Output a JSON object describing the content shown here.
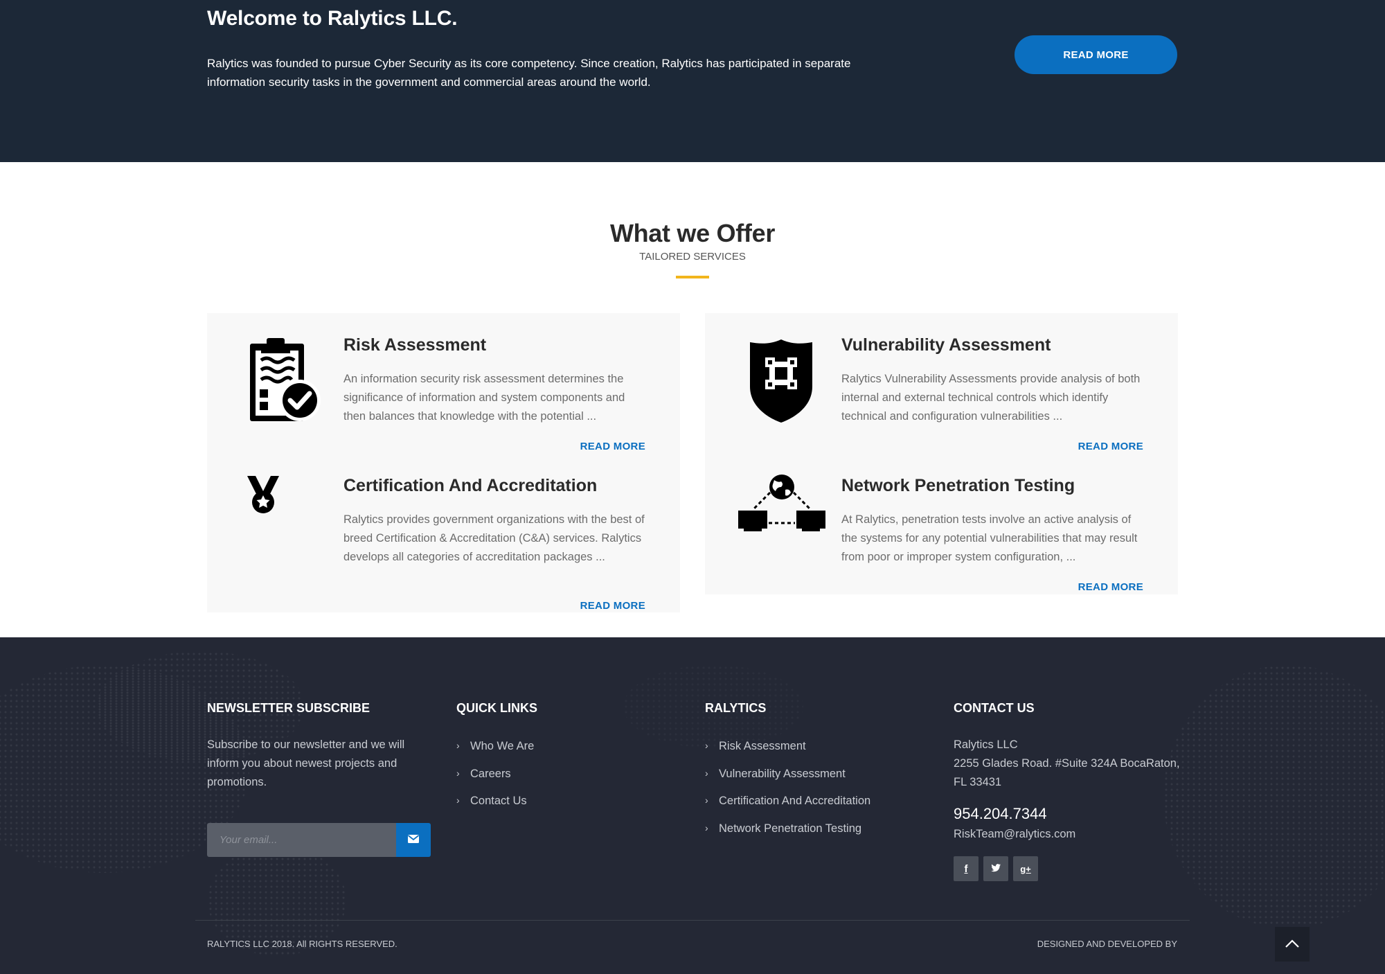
{
  "hero": {
    "title": "Welcome to Ralytics LLC.",
    "text": "Ralytics was founded to pursue Cyber Security as its core competency. Since creation, Ralytics has participated in separate information security tasks in the government and commercial areas around the world.",
    "button": "READ MORE"
  },
  "offer": {
    "title": "What we Offer",
    "subtitle": "TAILORED SERVICES",
    "services": [
      {
        "title": "Risk Assessment",
        "desc": "An information security risk assessment determines the significance of information and system components and then balances that knowledge with the potential ...",
        "more": "READ MORE",
        "icon": "clipboard-check-icon"
      },
      {
        "title": "Certification And Accreditation",
        "desc": "Ralytics provides government organizations with the best of breed Certification & Accreditation (C&A) services. Ralytics develops all categories of accreditation packages ...",
        "more": "READ MORE",
        "icon": "medal-icon"
      },
      {
        "title": "Vulnerability Assessment",
        "desc": "Ralytics Vulnerability Assessments provide analysis of both internal and external technical controls which identify technical and configuration vulnerabilities ...",
        "more": "READ MORE",
        "icon": "shield-icon"
      },
      {
        "title": "Network Penetration Testing",
        "desc": "At Ralytics, penetration tests involve an active analysis of the systems for any potential vulnerabilities that may result from poor or improper system configuration, ...",
        "more": "READ MORE",
        "icon": "network-icon"
      }
    ]
  },
  "footer": {
    "newsletter": {
      "heading": "NEWSLETTER SUBSCRIBE",
      "text": "Subscribe to our newsletter and we will inform you about newest projects and promotions.",
      "placeholder": "Your email...",
      "button_icon": "envelope-icon"
    },
    "quick_links": {
      "heading": "QUICK LINKS",
      "items": [
        "Who We Are",
        "Careers",
        "Contact Us"
      ]
    },
    "ralytics": {
      "heading": "RALYTICS",
      "items": [
        "Risk Assessment",
        "Vulnerability Assessment",
        "Certification And Accreditation",
        "Network Penetration Testing"
      ]
    },
    "contact": {
      "heading": "CONTACT US",
      "company": "Ralytics LLC",
      "address1": "2255 Glades Road. #Suite 324A BocaRaton,",
      "address2": "FL 33431",
      "phone": "954.204.7344",
      "email": "RiskTeam@ralytics.com",
      "social": [
        {
          "icon": "facebook-icon",
          "glyph": "f"
        },
        {
          "icon": "twitter-icon",
          "glyph": "t"
        },
        {
          "icon": "google-plus-icon",
          "glyph": "g+"
        }
      ]
    },
    "copyright": "RALYTICS LLC 2018. All RIGHTS RESERVED.",
    "designed": "DESIGNED AND DEVELOPED BY"
  },
  "colors": {
    "hero_bg": "#1c2837",
    "accent": "#0b6fc0",
    "underline": "#f2b51c",
    "footer_bg": "#242835"
  }
}
